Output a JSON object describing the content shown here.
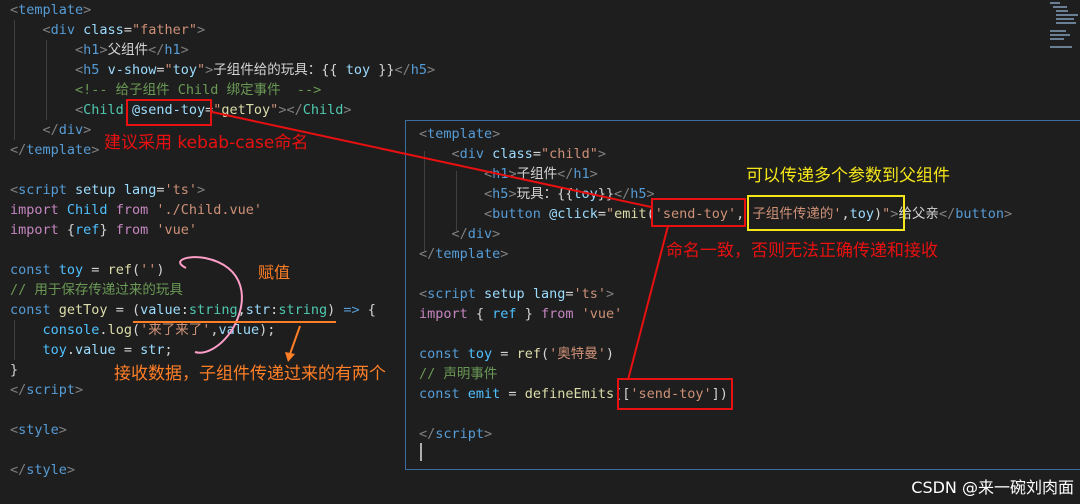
{
  "father_code": [
    [
      [
        "tagb",
        "<"
      ],
      [
        "tag",
        "template"
      ],
      [
        "tagb",
        ">"
      ]
    ],
    [
      [
        "txt",
        "    "
      ],
      [
        "tagb",
        "<"
      ],
      [
        "tag",
        "div "
      ],
      [
        "attr",
        "class"
      ],
      [
        "txt",
        "="
      ],
      [
        "str",
        "\"father\""
      ],
      [
        "tagb",
        ">"
      ]
    ],
    [
      [
        "txt",
        "        "
      ],
      [
        "tagb",
        "<"
      ],
      [
        "tag",
        "h1"
      ],
      [
        "tagb",
        ">"
      ],
      [
        "txt",
        "父组件"
      ],
      [
        "tagb",
        "</"
      ],
      [
        "tag",
        "h1"
      ],
      [
        "tagb",
        ">"
      ]
    ],
    [
      [
        "txt",
        "        "
      ],
      [
        "tagb",
        "<"
      ],
      [
        "tag",
        "h5 "
      ],
      [
        "attr",
        "v-show"
      ],
      [
        "txt",
        "="
      ],
      [
        "str",
        "\""
      ],
      [
        "attr",
        "toy"
      ],
      [
        "str",
        "\""
      ],
      [
        "tagb",
        ">"
      ],
      [
        "txt",
        "子组件给的玩具：{{ "
      ],
      [
        "attr",
        "toy"
      ],
      [
        "txt",
        " }}"
      ],
      [
        "tagb",
        "</"
      ],
      [
        "tag",
        "h5"
      ],
      [
        "tagb",
        ">"
      ]
    ],
    [
      [
        "txt",
        "        "
      ],
      [
        "cmt",
        "<!-- 给子组件 Child 绑定事件  -->"
      ]
    ],
    [
      [
        "txt",
        "        "
      ],
      [
        "tagb",
        "<"
      ],
      [
        "type",
        "Child "
      ],
      [
        "attr",
        "@send-toy"
      ],
      [
        "txt",
        "="
      ],
      [
        "str",
        "\""
      ],
      [
        "fn",
        "getToy"
      ],
      [
        "str",
        "\""
      ],
      [
        "tagb",
        "></"
      ],
      [
        "type",
        "Child"
      ],
      [
        "tagb",
        ">"
      ]
    ],
    [
      [
        "txt",
        "    "
      ],
      [
        "tagb",
        "</"
      ],
      [
        "tag",
        "div"
      ],
      [
        "tagb",
        ">"
      ]
    ],
    [
      [
        "tagb",
        "</"
      ],
      [
        "tag",
        "template"
      ],
      [
        "tagb",
        ">"
      ]
    ],
    [
      [
        "txt",
        ""
      ]
    ],
    [
      [
        "tagb",
        "<"
      ],
      [
        "tag",
        "script "
      ],
      [
        "attr",
        "setup "
      ],
      [
        "attr",
        "lang"
      ],
      [
        "txt",
        "="
      ],
      [
        "str",
        "'ts'"
      ],
      [
        "tagb",
        ">"
      ]
    ],
    [
      [
        "kw",
        "import "
      ],
      [
        "var",
        "Child "
      ],
      [
        "kw",
        "from "
      ],
      [
        "str",
        "'./Child.vue'"
      ]
    ],
    [
      [
        "kw",
        "import "
      ],
      [
        "txt",
        "{"
      ],
      [
        "var",
        "ref"
      ],
      [
        "txt",
        "} "
      ],
      [
        "kw",
        "from "
      ],
      [
        "str",
        "'vue'"
      ]
    ],
    [
      [
        "txt",
        ""
      ]
    ],
    [
      [
        "kw2",
        "const "
      ],
      [
        "var",
        "toy "
      ],
      [
        "txt",
        "= "
      ],
      [
        "fn",
        "ref"
      ],
      [
        "txt",
        "("
      ],
      [
        "str",
        "''"
      ],
      [
        "txt",
        ")"
      ]
    ],
    [
      [
        "cmt",
        "// 用于保存传递过来的玩具"
      ]
    ],
    [
      [
        "kw2",
        "const "
      ],
      [
        "fn",
        "getToy "
      ],
      [
        "txt",
        "= ("
      ],
      [
        "attr",
        "value"
      ],
      [
        "txt",
        ":"
      ],
      [
        "type",
        "string"
      ],
      [
        "txt",
        ","
      ],
      [
        "attr",
        "str"
      ],
      [
        "txt",
        ":"
      ],
      [
        "type",
        "string"
      ],
      [
        "txt",
        ") "
      ],
      [
        "kw2",
        "=> "
      ],
      [
        "txt",
        "{"
      ]
    ],
    [
      [
        "txt",
        "    "
      ],
      [
        "var",
        "console"
      ],
      [
        "txt",
        "."
      ],
      [
        "fn",
        "log"
      ],
      [
        "txt",
        "("
      ],
      [
        "str",
        "'来了来了'"
      ],
      [
        "txt",
        ","
      ],
      [
        "attr",
        "value"
      ],
      [
        "txt",
        ");"
      ]
    ],
    [
      [
        "txt",
        "    "
      ],
      [
        "var",
        "toy"
      ],
      [
        "txt",
        "."
      ],
      [
        "attr",
        "value "
      ],
      [
        "txt",
        "= "
      ],
      [
        "attr",
        "str"
      ],
      [
        "txt",
        ";"
      ]
    ],
    [
      [
        "txt",
        "}"
      ]
    ],
    [
      [
        "tagb",
        "</"
      ],
      [
        "tag",
        "script"
      ],
      [
        "tagb",
        ">"
      ]
    ],
    [
      [
        "txt",
        ""
      ]
    ],
    [
      [
        "tagb",
        "<"
      ],
      [
        "tag",
        "style"
      ],
      [
        "tagb",
        ">"
      ]
    ],
    [
      [
        "txt",
        ""
      ]
    ],
    [
      [
        "tagb",
        "</"
      ],
      [
        "tag",
        "style"
      ],
      [
        "tagb",
        ">"
      ]
    ]
  ],
  "child_code": [
    [
      [
        "tagb",
        "<"
      ],
      [
        "tag",
        "template"
      ],
      [
        "tagb",
        ">"
      ]
    ],
    [
      [
        "txt",
        "    "
      ],
      [
        "tagb",
        "<"
      ],
      [
        "tag",
        "div "
      ],
      [
        "attr",
        "class"
      ],
      [
        "txt",
        "="
      ],
      [
        "str",
        "\"child\""
      ],
      [
        "tagb",
        ">"
      ]
    ],
    [
      [
        "txt",
        "        "
      ],
      [
        "tagb",
        "<"
      ],
      [
        "tag",
        "h1"
      ],
      [
        "tagb",
        ">"
      ],
      [
        "txt",
        "子组件"
      ],
      [
        "tagb",
        "</"
      ],
      [
        "tag",
        "h1"
      ],
      [
        "tagb",
        ">"
      ]
    ],
    [
      [
        "txt",
        "        "
      ],
      [
        "tagb",
        "<"
      ],
      [
        "tag",
        "h5"
      ],
      [
        "tagb",
        ">"
      ],
      [
        "txt",
        "玩具：{{"
      ],
      [
        "attr",
        "toy"
      ],
      [
        "txt",
        "}}"
      ],
      [
        "tagb",
        "</"
      ],
      [
        "tag",
        "h5"
      ],
      [
        "tagb",
        ">"
      ]
    ],
    [
      [
        "txt",
        "        "
      ],
      [
        "tagb",
        "<"
      ],
      [
        "tag",
        "button "
      ],
      [
        "attr",
        "@click"
      ],
      [
        "txt",
        "="
      ],
      [
        "str",
        "\""
      ],
      [
        "fn",
        "emit"
      ],
      [
        "txt",
        "("
      ],
      [
        "str",
        "'send-toy'"
      ],
      [
        "txt",
        ","
      ],
      [
        "str",
        "'子组件传递的'"
      ],
      [
        "txt",
        ","
      ],
      [
        "attr",
        "toy"
      ],
      [
        "txt",
        ")"
      ],
      [
        "str",
        "\""
      ],
      [
        "tagb",
        ">"
      ],
      [
        "txt",
        "给父亲"
      ],
      [
        "tagb",
        "</"
      ],
      [
        "tag",
        "button"
      ],
      [
        "tagb",
        ">"
      ]
    ],
    [
      [
        "txt",
        "    "
      ],
      [
        "tagb",
        "</"
      ],
      [
        "tag",
        "div"
      ],
      [
        "tagb",
        ">"
      ]
    ],
    [
      [
        "tagb",
        "</"
      ],
      [
        "tag",
        "template"
      ],
      [
        "tagb",
        ">"
      ]
    ],
    [
      [
        "txt",
        ""
      ]
    ],
    [
      [
        "tagb",
        "<"
      ],
      [
        "tag",
        "script "
      ],
      [
        "attr",
        "setup "
      ],
      [
        "attr",
        "lang"
      ],
      [
        "txt",
        "="
      ],
      [
        "str",
        "'ts'"
      ],
      [
        "tagb",
        ">"
      ]
    ],
    [
      [
        "kw",
        "import "
      ],
      [
        "txt",
        "{ "
      ],
      [
        "var",
        "ref "
      ],
      [
        "txt",
        "} "
      ],
      [
        "kw",
        "from "
      ],
      [
        "str",
        "'vue'"
      ]
    ],
    [
      [
        "txt",
        ""
      ]
    ],
    [
      [
        "kw2",
        "const "
      ],
      [
        "var",
        "toy "
      ],
      [
        "txt",
        "= "
      ],
      [
        "fn",
        "ref"
      ],
      [
        "txt",
        "("
      ],
      [
        "str",
        "'奥特曼'"
      ],
      [
        "txt",
        ")"
      ]
    ],
    [
      [
        "cmt",
        "// 声明事件"
      ]
    ],
    [
      [
        "kw2",
        "const "
      ],
      [
        "var",
        "emit "
      ],
      [
        "txt",
        "= "
      ],
      [
        "fn",
        "defineEmits"
      ],
      [
        "txt",
        "(["
      ],
      [
        "str",
        "'send-toy'"
      ],
      [
        "txt",
        "])"
      ]
    ],
    [
      [
        "txt",
        ""
      ]
    ],
    [
      [
        "tagb",
        "</"
      ],
      [
        "tag",
        "script"
      ],
      [
        "tagb",
        ">"
      ]
    ]
  ],
  "annotations": {
    "kebab_case": "建议采用 kebab-case命名",
    "assign": "赋值",
    "receive": "接收数据，子组件传递过来的有两个",
    "multi_params": "可以传递多个参数到父组件",
    "name_consistent": "命名一致，否则无法正确传递和接收"
  },
  "colors": {
    "red": "#e81010",
    "yellow": "#f5e61a",
    "orange": "#ff7f27",
    "pink": "#ff9ec8"
  },
  "watermark": "CSDN @来一碗刘肉面"
}
